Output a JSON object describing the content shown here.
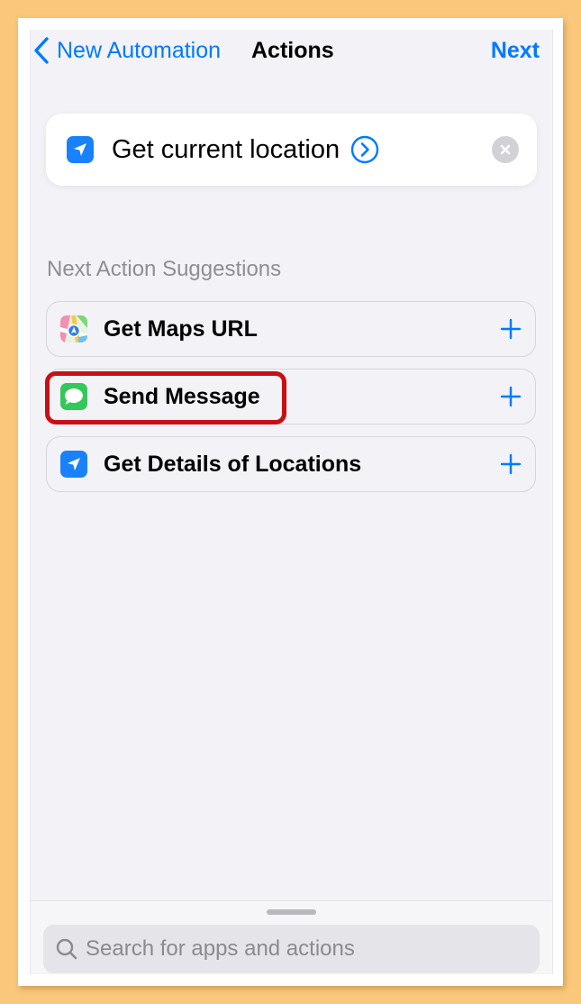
{
  "theme": {
    "accent": "#007AFF",
    "highlight": "#C80F14",
    "screen_background": "#F2F2F7",
    "page_background": "#FBC77B"
  },
  "nav": {
    "back_label": "New Automation",
    "back_icon": "chevron-left-icon",
    "title": "Actions",
    "next_label": "Next"
  },
  "action": {
    "label": "Get current location",
    "icon": "location-arrow-icon",
    "detail_icon": "chevron-right-circle-icon",
    "remove_icon": "clear-x-icon"
  },
  "suggestions": {
    "header": "Next Action Suggestions",
    "items": [
      {
        "label": "Get Maps URL",
        "icon": "maps-icon",
        "add_icon": "plus-icon"
      },
      {
        "label": "Send Message",
        "icon": "messages-icon",
        "add_icon": "plus-icon",
        "highlighted": true
      },
      {
        "label": "Get Details of Locations",
        "icon": "location-arrow-icon",
        "add_icon": "plus-icon"
      }
    ]
  },
  "search": {
    "placeholder": "Search for apps and actions",
    "value": "",
    "icon": "magnifier-icon"
  }
}
